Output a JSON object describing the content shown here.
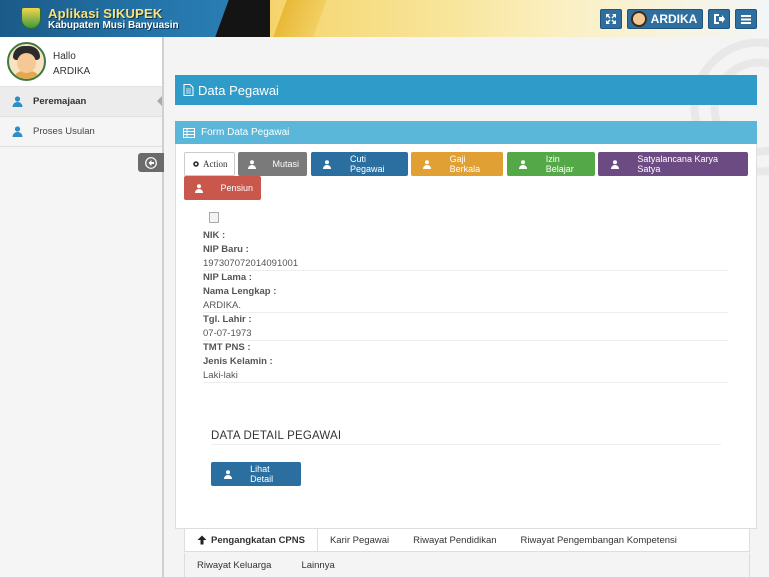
{
  "header": {
    "app_title": "Aplikasi SIKUPEK",
    "app_subtitle": "Kabupaten Musi Banyuasin",
    "user_label": "ARDIKA",
    "icons": [
      "expand-icon",
      "logout-icon",
      "menu-icon"
    ]
  },
  "sidebar": {
    "greeting": "Hallo",
    "username": "ARDIKA",
    "items": [
      {
        "label": "Peremajaan",
        "icon": "user-icon",
        "active": true
      },
      {
        "label": "Proses Usulan",
        "icon": "user-icon",
        "active": false
      }
    ]
  },
  "main": {
    "page_title": "Data Pegawai",
    "form_title": "Form Data Pegawai",
    "action_buttons": [
      {
        "label": "Action",
        "color": "#ffffff"
      },
      {
        "label": "Mutasi",
        "color": "#7a7a7a"
      },
      {
        "label": "Cuti Pegawai",
        "color": "#2a6fa0"
      },
      {
        "label": "Gaji Berkala",
        "color": "#e0a033"
      },
      {
        "label": "Izin Belajar",
        "color": "#55a847"
      },
      {
        "label": "Satyalancana Karya Satya",
        "color": "#6c4a82"
      },
      {
        "label": "Pensiun",
        "color": "#c9574c"
      }
    ],
    "fields": [
      {
        "label": "NIK :",
        "value": ""
      },
      {
        "label": "NIP Baru :",
        "value": "197307072014091001"
      },
      {
        "label": "NIP Lama :",
        "value": ""
      },
      {
        "label": "Nama Lengkap :",
        "value": "ARDIKA."
      },
      {
        "label": "Tgl. Lahir :",
        "value": "07-07-1973"
      },
      {
        "label": "TMT PNS :",
        "value": ""
      },
      {
        "label": "Jenis Kelamin :",
        "value": "Laki-laki"
      }
    ],
    "detail_title": "DATA DETAIL PEGAWAI",
    "detail_button": "Lihat Detail",
    "tabs_row1": [
      "Pengangkatan CPNS",
      "Karir Pegawai",
      "Riwayat Pendidikan",
      "Riwayat Pengembangan Kompetensi"
    ],
    "tabs_row2": [
      "Riwayat Keluarga",
      "Lainnya"
    ]
  }
}
